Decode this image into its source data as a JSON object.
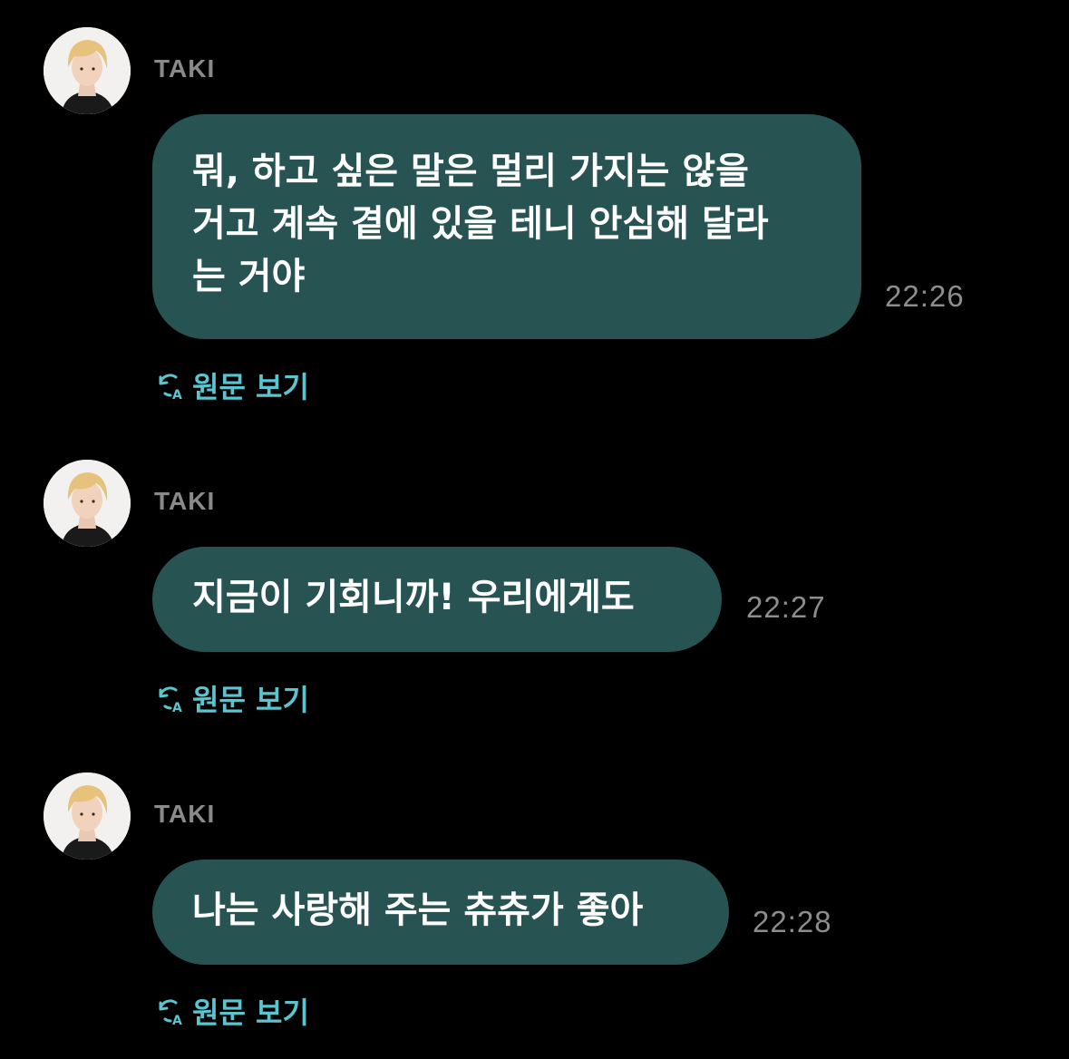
{
  "messages": [
    {
      "sender": "TAKI",
      "text": "뭐, 하고 싶은 말은 멀리 가지는 않을\n거고 계속 곁에 있을 테니 안심해 달라\n는 거야",
      "time": "22:26",
      "view_original": "원문 보기",
      "avatar_icon": "profile-photo"
    },
    {
      "sender": "TAKI",
      "text": "지금이 기회니까! 우리에게도",
      "time": "22:27",
      "view_original": "원문 보기",
      "avatar_icon": "profile-photo"
    },
    {
      "sender": "TAKI",
      "text": "나는 사랑해 주는 츄츄가 좋아",
      "time": "22:28",
      "view_original": "원문 보기",
      "avatar_icon": "profile-photo"
    }
  ],
  "colors": {
    "background": "#000000",
    "bubble": "#275452",
    "bubble_text": "#ffffff",
    "sender": "#8a8a8a",
    "time": "#8d8d8d",
    "link": "#5cc4cf"
  },
  "icons": {
    "translate": "translate-refresh-icon"
  }
}
